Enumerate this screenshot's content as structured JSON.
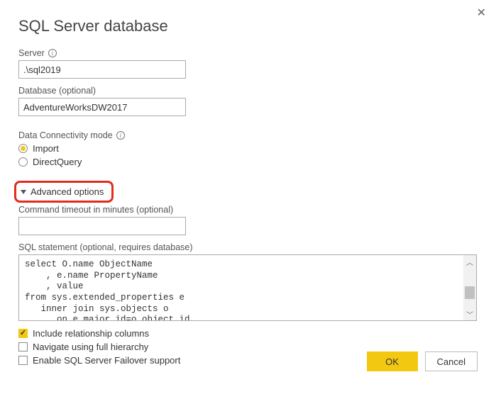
{
  "title": "SQL Server database",
  "server": {
    "label": "Server",
    "value": ".\\sql2019"
  },
  "database": {
    "label": "Database (optional)",
    "value": "AdventureWorksDW2017"
  },
  "connectivity": {
    "label": "Data Connectivity mode",
    "options": {
      "import": "Import",
      "directquery": "DirectQuery"
    },
    "selected": "import"
  },
  "advanced": {
    "toggle": "Advanced options",
    "timeout_label": "Command timeout in minutes (optional)",
    "timeout_value": "",
    "sql_label": "SQL statement (optional, requires database)",
    "sql_value": "select O.name ObjectName\n    , e.name PropertyName\n    , value\nfrom sys.extended_properties e\n   inner join sys.objects o\n      on e.major_id=o.object_id"
  },
  "checks": {
    "relationship": {
      "label": "Include relationship columns",
      "checked": true
    },
    "hierarchy": {
      "label": "Navigate using full hierarchy",
      "checked": false
    },
    "failover": {
      "label": "Enable SQL Server Failover support",
      "checked": false
    }
  },
  "buttons": {
    "ok": "OK",
    "cancel": "Cancel"
  }
}
